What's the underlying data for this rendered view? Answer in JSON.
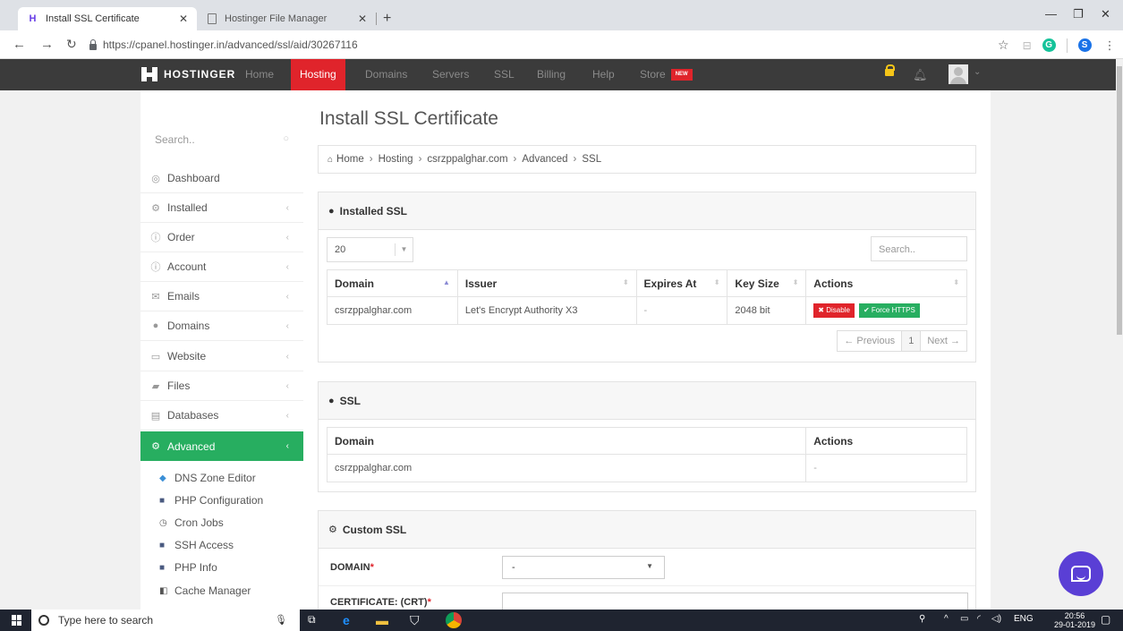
{
  "browser": {
    "tabs": [
      {
        "label": "Install SSL Certificate",
        "active": true
      },
      {
        "label": "Hostinger File Manager",
        "active": false
      }
    ],
    "url": "https://cpanel.hostinger.in/advanced/ssl/aid/30267116"
  },
  "header": {
    "brand": "HOSTINGER",
    "nav": [
      "Home",
      "Hosting",
      "Domains",
      "Servers",
      "SSL",
      "Billing",
      "Help",
      "Store"
    ],
    "active_nav": "Hosting",
    "new_badge": "NEW"
  },
  "sidebar": {
    "search_placeholder": "Search..",
    "items": [
      {
        "label": "Dashboard",
        "icon": "dashboard-icon"
      },
      {
        "label": "Installed",
        "icon": "cogs-icon"
      },
      {
        "label": "Order",
        "icon": "info-icon"
      },
      {
        "label": "Account",
        "icon": "info-icon"
      },
      {
        "label": "Emails",
        "icon": "envelope-icon"
      },
      {
        "label": "Domains",
        "icon": "globe-icon"
      },
      {
        "label": "Website",
        "icon": "monitor-icon"
      },
      {
        "label": "Files",
        "icon": "folder-icon"
      },
      {
        "label": "Databases",
        "icon": "database-icon"
      },
      {
        "label": "Advanced",
        "icon": "cogs-icon",
        "active": true
      }
    ],
    "sub_items": [
      {
        "label": "DNS Zone Editor",
        "icon": "dns-icon"
      },
      {
        "label": "PHP Configuration",
        "icon": "php-icon"
      },
      {
        "label": "Cron Jobs",
        "icon": "clock-icon"
      },
      {
        "label": "SSH Access",
        "icon": "ssh-icon"
      },
      {
        "label": "PHP Info",
        "icon": "php-icon"
      },
      {
        "label": "Cache Manager",
        "icon": "cache-icon"
      }
    ]
  },
  "main": {
    "title": "Install SSL Certificate",
    "breadcrumb": [
      "Home",
      "Hosting",
      "csrzppalghar.com",
      "Advanced",
      "SSL"
    ],
    "installed_ssl": {
      "heading": "Installed SSL",
      "page_length": "20",
      "search_placeholder": "Search..",
      "columns": [
        "Domain",
        "Issuer",
        "Expires At",
        "Key Size",
        "Actions"
      ],
      "rows": [
        {
          "domain": "csrzppalghar.com",
          "issuer": "Let's Encrypt Authority X3",
          "expires": "-",
          "key_size": "2048 bit"
        }
      ],
      "disable_label": "Disable",
      "force_https_label": "Force HTTPS",
      "pager": {
        "previous": "← Previous",
        "page": "1",
        "next": "Next →"
      }
    },
    "ssl": {
      "heading": "SSL",
      "columns": [
        "Domain",
        "Actions"
      ],
      "rows": [
        {
          "domain": "csrzppalghar.com",
          "actions": "-"
        }
      ]
    },
    "custom_ssl": {
      "heading": "Custom SSL",
      "domain_label": "DOMAIN",
      "domain_value": "-",
      "certificate_label": "CERTIFICATE: (CRT)"
    }
  },
  "taskbar": {
    "search_placeholder": "Type here to search",
    "lang": "ENG",
    "time": "20:56",
    "date": "29-01-2019"
  }
}
